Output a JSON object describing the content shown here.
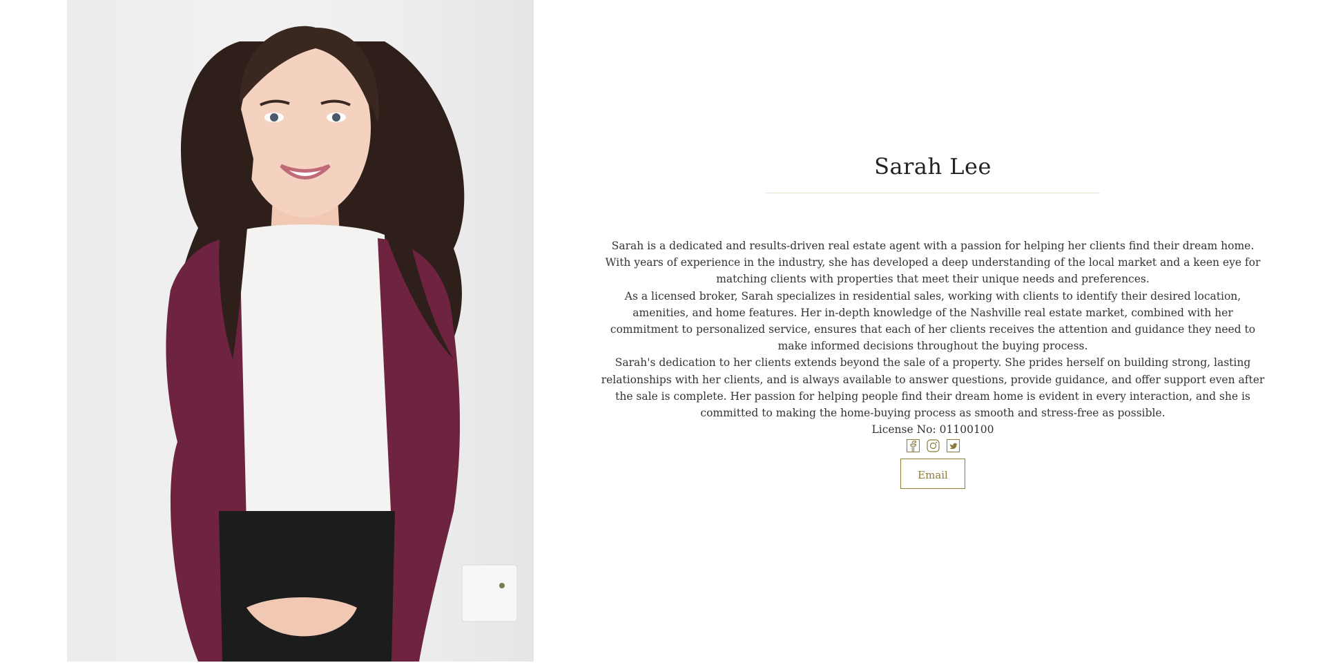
{
  "agent": {
    "name": "Sarah Lee",
    "photo_alt": "Sarah Lee portrait",
    "bio": [
      "Sarah is a dedicated and results-driven real estate agent with a passion for helping her clients find their dream home. With years of experience in the industry, she has developed a deep understanding of the local market and a keen eye for matching clients with properties that meet their unique needs and preferences.",
      "As a licensed broker, Sarah specializes in residential sales, working with clients to identify their desired location, amenities, and home features. Her in-depth knowledge of the Nashville real estate market, combined with her commitment to personalized service, ensures that each of her clients receives the attention and guidance they need to make informed decisions throughout the buying process.",
      "Sarah's dedication to her clients extends beyond the sale of a property. She prides herself on building strong, lasting relationships with her clients, and is always available to answer questions, provide guidance, and offer support even after the sale is complete. Her passion for helping people find their dream home is evident in every interaction, and she is committed to making the home-buying process as smooth and stress-free as possible."
    ],
    "license": "License No: 01100100",
    "socials": [
      {
        "icon": "facebook-icon"
      },
      {
        "icon": "instagram-icon"
      },
      {
        "icon": "twitter-icon"
      }
    ],
    "email_label": "Email"
  },
  "colors": {
    "accent": "#8a7a3a",
    "divider": "#e6e1cf",
    "cardigan": "#6e2340",
    "hair": "#2e1f1a",
    "top": "#f4f3f1",
    "skirt": "#1c1c1c"
  }
}
